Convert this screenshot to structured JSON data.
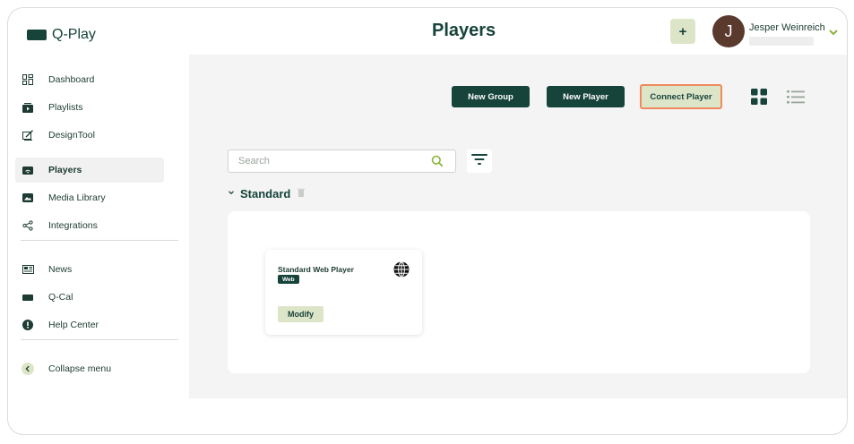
{
  "app": {
    "name": "Q-Play",
    "page_title": "Players"
  },
  "header": {
    "add_label": "+",
    "user": {
      "initial": "J",
      "name": "Jesper Weinreich"
    }
  },
  "sidebar": {
    "items": [
      {
        "label": "Dashboard",
        "icon": "dashboard-icon"
      },
      {
        "label": "Playlists",
        "icon": "playlists-icon"
      },
      {
        "label": "DesignTool",
        "icon": "design-tool-icon"
      },
      {
        "label": "Players",
        "icon": "players-icon",
        "active": true
      },
      {
        "label": "Media Library",
        "icon": "media-library-icon"
      },
      {
        "label": "Integrations",
        "icon": "integrations-icon"
      }
    ],
    "secondary": [
      {
        "label": "News",
        "icon": "news-icon"
      },
      {
        "label": "Q-Cal",
        "icon": "q-cal-icon"
      },
      {
        "label": "Help Center",
        "icon": "help-center-icon"
      }
    ],
    "collapse": {
      "label": "Collapse menu",
      "icon": "chevron-left-icon"
    }
  },
  "toolbar": {
    "new_group": "New Group",
    "new_player": "New Player",
    "connect_player": "Connect Player",
    "grid_view_icon": "grid-view-icon",
    "list_view_icon": "list-view-icon"
  },
  "search": {
    "placeholder": "Search"
  },
  "groups": [
    {
      "name": "Standard",
      "players": [
        {
          "name": "Standard Web Player",
          "badge": "Web",
          "action": "Modify"
        }
      ]
    }
  ],
  "colors": {
    "brand": "#16433a",
    "accent_light": "#dde5c9",
    "highlight_border": "#f08a5d",
    "background": "#f4f4f4"
  }
}
